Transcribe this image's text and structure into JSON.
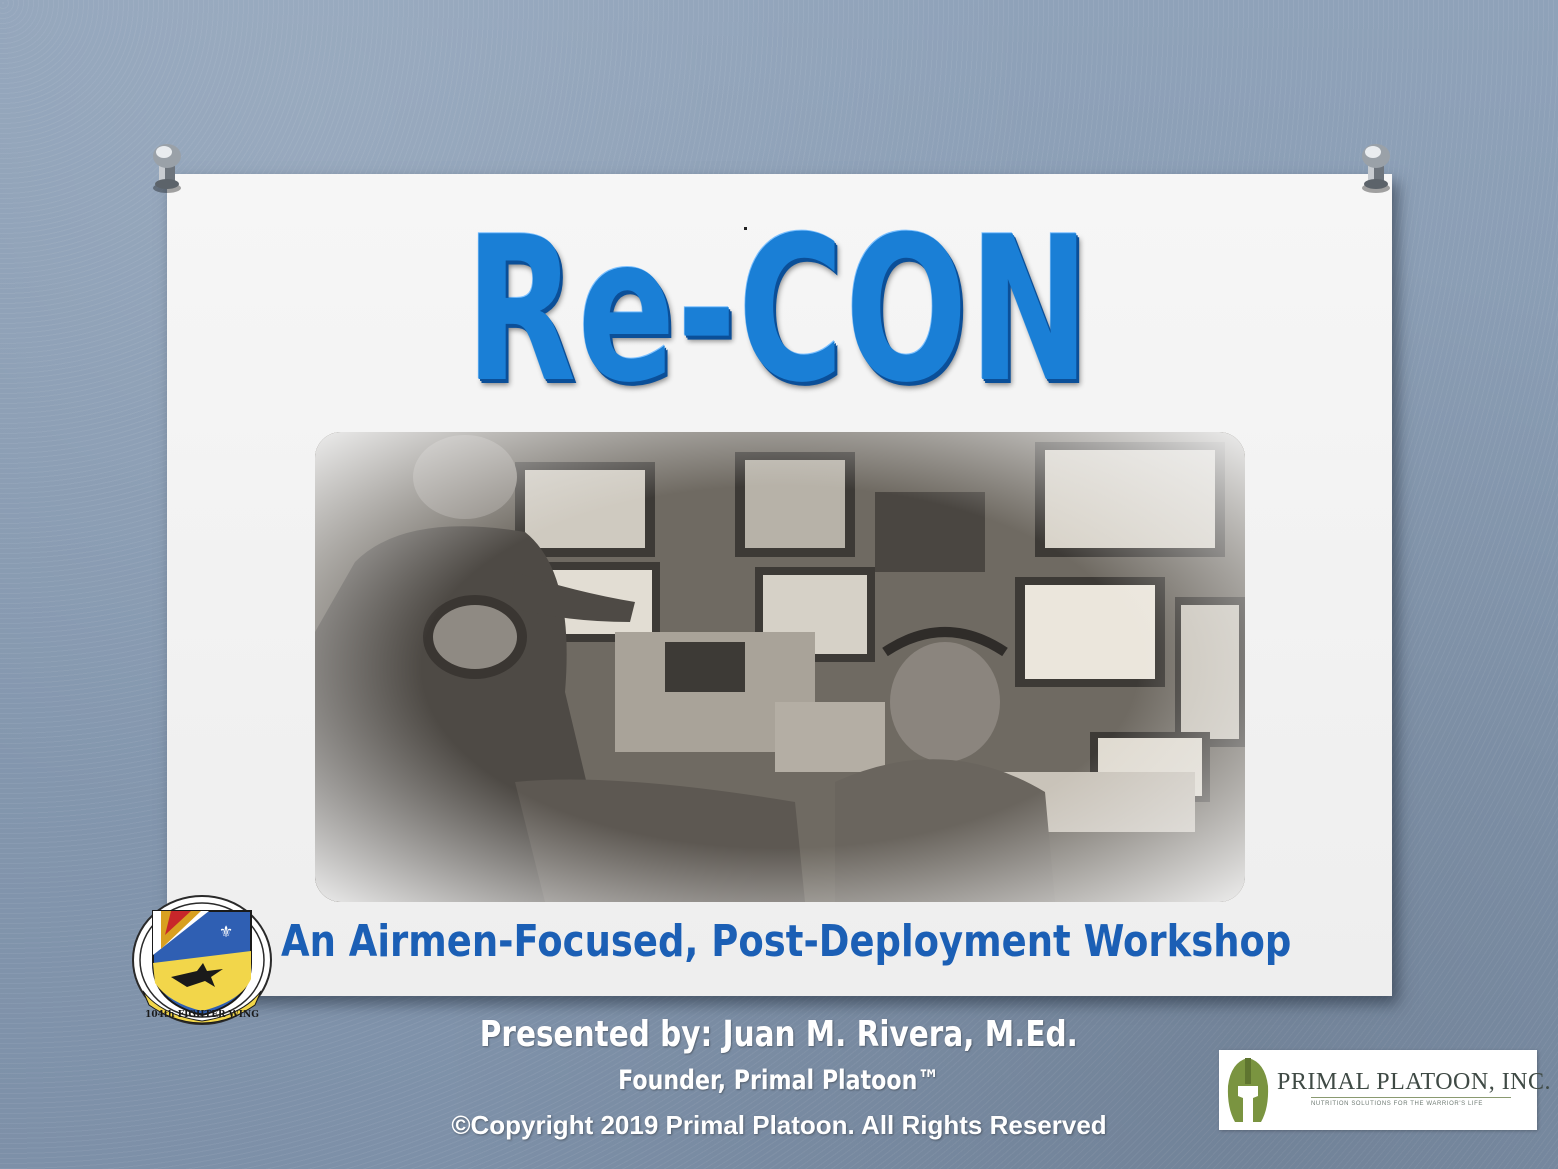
{
  "slide": {
    "title": "Re-CON",
    "subtitle": "An Airmen-Focused, Post-Deployment Workshop",
    "presenter": "Presented by: Juan M. Rivera, M.Ed.",
    "presenter_role": "Founder, Primal Platoon™",
    "copyright": "©Copyright 2019 Primal Platoon.  All Rights Reserved"
  },
  "emblem": {
    "text": "104th FIGHTER WING",
    "icon": "fighter-wing-shield-icon"
  },
  "company_logo": {
    "name": "PRIMAL PLATOON, INC.",
    "tagline": "NUTRITION SOLUTIONS FOR THE WARRIOR'S LIFE",
    "icon": "spartan-helmet-icon"
  },
  "photo": {
    "icon": "control-room-photo"
  },
  "colors": {
    "title_blue": "#1a7fd6",
    "subtitle_blue": "#1b5fb5",
    "background": "#8699b0",
    "card": "#f2f2f2",
    "logo_green": "#7a9440"
  }
}
